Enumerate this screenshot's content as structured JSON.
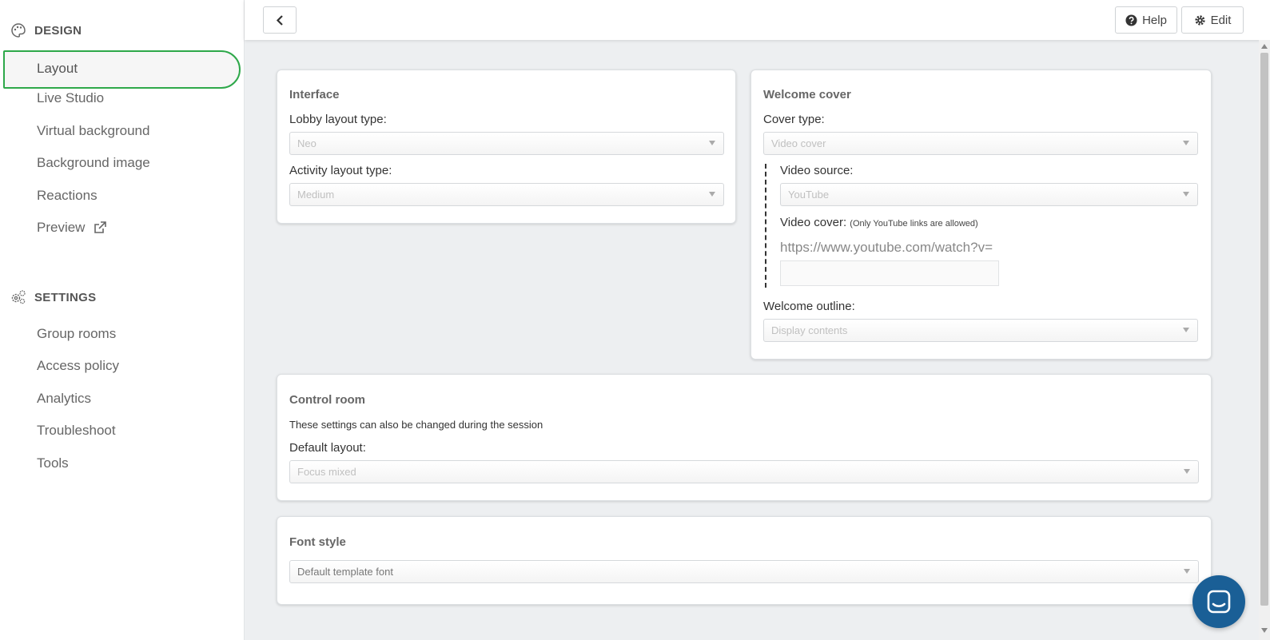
{
  "sidebar": {
    "design_heading": "DESIGN",
    "design_items": [
      "Layout",
      "Live Studio",
      "Virtual background",
      "Background image",
      "Reactions",
      "Preview"
    ],
    "settings_heading": "SETTINGS",
    "settings_items": [
      "Group rooms",
      "Access policy",
      "Analytics",
      "Troubleshoot",
      "Tools"
    ],
    "active_item": "Layout",
    "active_color": "#2ea84a"
  },
  "topbar": {
    "help_label": "Help",
    "edit_label": "Edit"
  },
  "interface": {
    "title": "Interface",
    "lobby_label": "Lobby layout type:",
    "lobby_value": "Neo",
    "activity_label": "Activity layout type:",
    "activity_value": "Medium"
  },
  "welcome": {
    "title": "Welcome cover",
    "cover_type_label": "Cover type:",
    "cover_type_value": "Video cover",
    "video_source_label": "Video source:",
    "video_source_value": "YouTube",
    "video_cover_label": "Video cover:",
    "video_cover_note": "(Only YouTube links are allowed)",
    "url_prefix": "https://www.youtube.com/watch?v=",
    "outline_label": "Welcome outline:",
    "outline_value": "Display contents"
  },
  "control_room": {
    "title": "Control room",
    "description": "These settings can also be changed during the session",
    "default_layout_label": "Default layout:",
    "default_layout_value": "Focus mixed"
  },
  "font_style": {
    "title": "Font style",
    "value": "Default template font"
  },
  "colors": {
    "chat_button": "#1a5f96"
  }
}
